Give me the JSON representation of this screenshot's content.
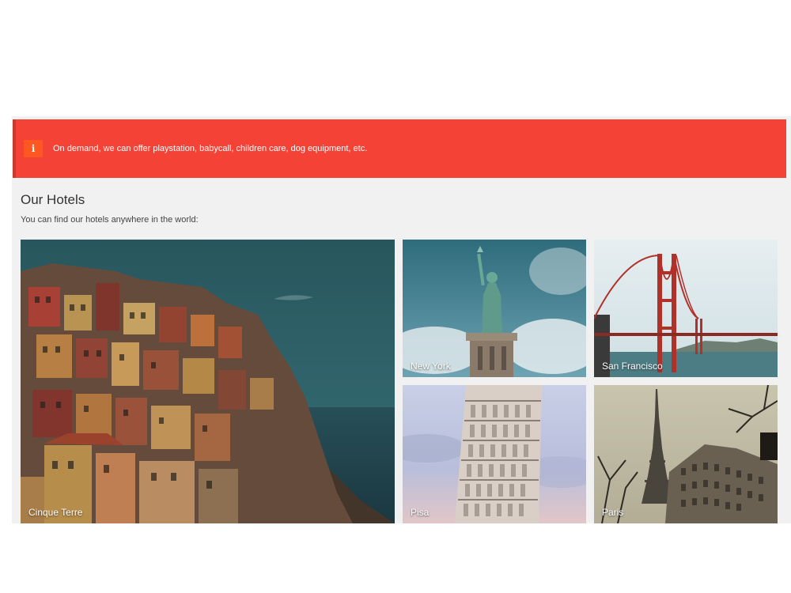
{
  "alert": {
    "icon": "info-icon",
    "icon_glyph": "i",
    "text": "On demand, we can offer playstation, babycall, children care, dog equipment, etc.",
    "color": "#f44336"
  },
  "section": {
    "title": "Our Hotels",
    "subtitle": "You can find our hotels anywhere in the world:"
  },
  "hotels": [
    {
      "label": "Cinque Terre"
    },
    {
      "label": "New York"
    },
    {
      "label": "San Francisco"
    },
    {
      "label": "Pisa"
    },
    {
      "label": "Paris"
    }
  ]
}
